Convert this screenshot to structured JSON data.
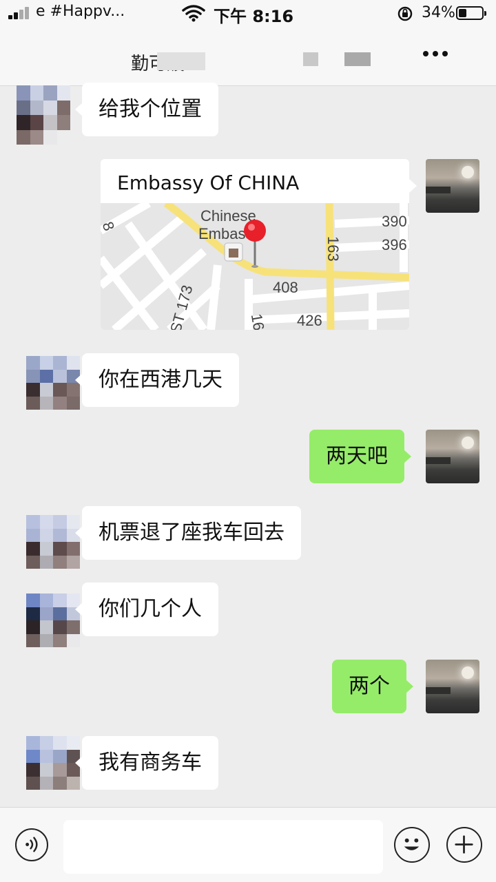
{
  "status_bar": {
    "carrier": "e #Happv...",
    "time": "下午 8:16",
    "battery": "34%",
    "battery_level": 0.34
  },
  "nav": {
    "title": "勤可媛",
    "more_icon": "more-icon"
  },
  "messages": [
    {
      "side": "peer",
      "type": "text",
      "text": "给我个位置"
    },
    {
      "side": "self",
      "type": "location",
      "title": "Embassy Of CHINA",
      "map_labels": [
        "Chinese",
        "Embassy",
        "163",
        "ST 173",
        "408",
        "426",
        "390",
        "396",
        "8",
        "16"
      ]
    },
    {
      "side": "peer",
      "type": "text",
      "text": "你在西港几天"
    },
    {
      "side": "self",
      "type": "text",
      "text": "两天吧"
    },
    {
      "side": "peer",
      "type": "text",
      "text": "机票退了座我车回去"
    },
    {
      "side": "peer",
      "type": "text",
      "text": "你们几个人"
    },
    {
      "side": "self",
      "type": "text",
      "text": "两个"
    },
    {
      "side": "peer",
      "type": "text",
      "text": "我有商务车"
    }
  ],
  "input_bar": {
    "voice_icon": "voice-icon",
    "emoji_icon": "emoji-icon",
    "plus_icon": "plus-icon",
    "input_value": ""
  },
  "colors": {
    "background": "#ededed",
    "self_bubble": "#95ec69",
    "peer_bubble": "#ffffff",
    "map_road": "#f7e27a",
    "pin": "#e8202a"
  }
}
